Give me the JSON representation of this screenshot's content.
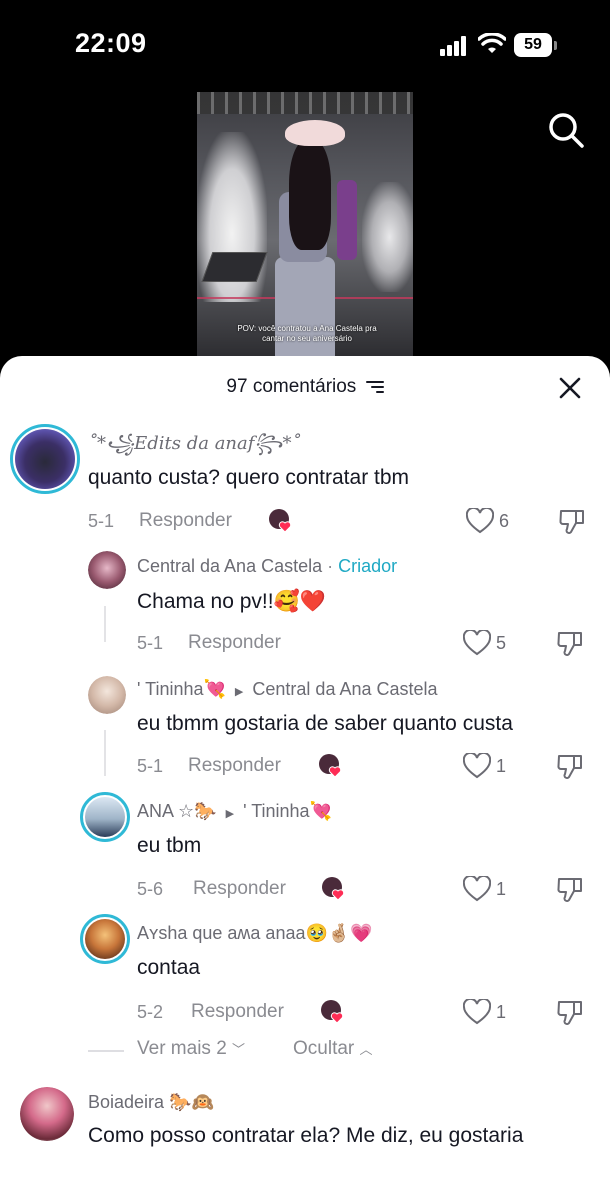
{
  "status_bar": {
    "time": "22:09",
    "battery": "59"
  },
  "video": {
    "caption": "POV: você contratou a Ana Castela pra cantar no seu aniversário"
  },
  "sheet": {
    "title": "97 comentários"
  },
  "comments": [
    {
      "username": "˚*꧁Edits da anaf꧂*˚",
      "text": "quanto custa? quero contratar tbm",
      "date": "5-1",
      "reply_label": "Responder",
      "likes": "6"
    },
    {
      "username": "Central da Ana Castela",
      "badge_sep": "·",
      "badge": "Criador",
      "text": "Chama no pv!!🥰❤️",
      "date": "5-1",
      "reply_label": "Responder",
      "likes": "5"
    },
    {
      "username": "' Tininha💘",
      "reply_to": "Central da Ana Castela",
      "text": "eu tbmm gostaria de saber quanto custa",
      "date": "5-1",
      "reply_label": "Responder",
      "likes": "1"
    },
    {
      "username": "ANA ☆🐎",
      "reply_to": "' Tininha💘",
      "text": "eu tbm",
      "date": "5-6",
      "reply_label": "Responder",
      "likes": "1"
    },
    {
      "username": "Aʏsha que aʍa anaa🥹🤞🏼💗",
      "text": "contaa",
      "date": "5-2",
      "reply_label": "Responder",
      "likes": "1"
    },
    {
      "username": "Boiadeira 🐎🙉",
      "text": "Como posso contratar ela? Me diz, eu gostaria"
    }
  ],
  "replies_controls": {
    "view_more": "Ver mais 2",
    "hide": "Ocultar"
  },
  "colors": {
    "creator": "#1fa9c4",
    "ring": "#2fb9d6",
    "heart_badge": "#fe2c55"
  }
}
